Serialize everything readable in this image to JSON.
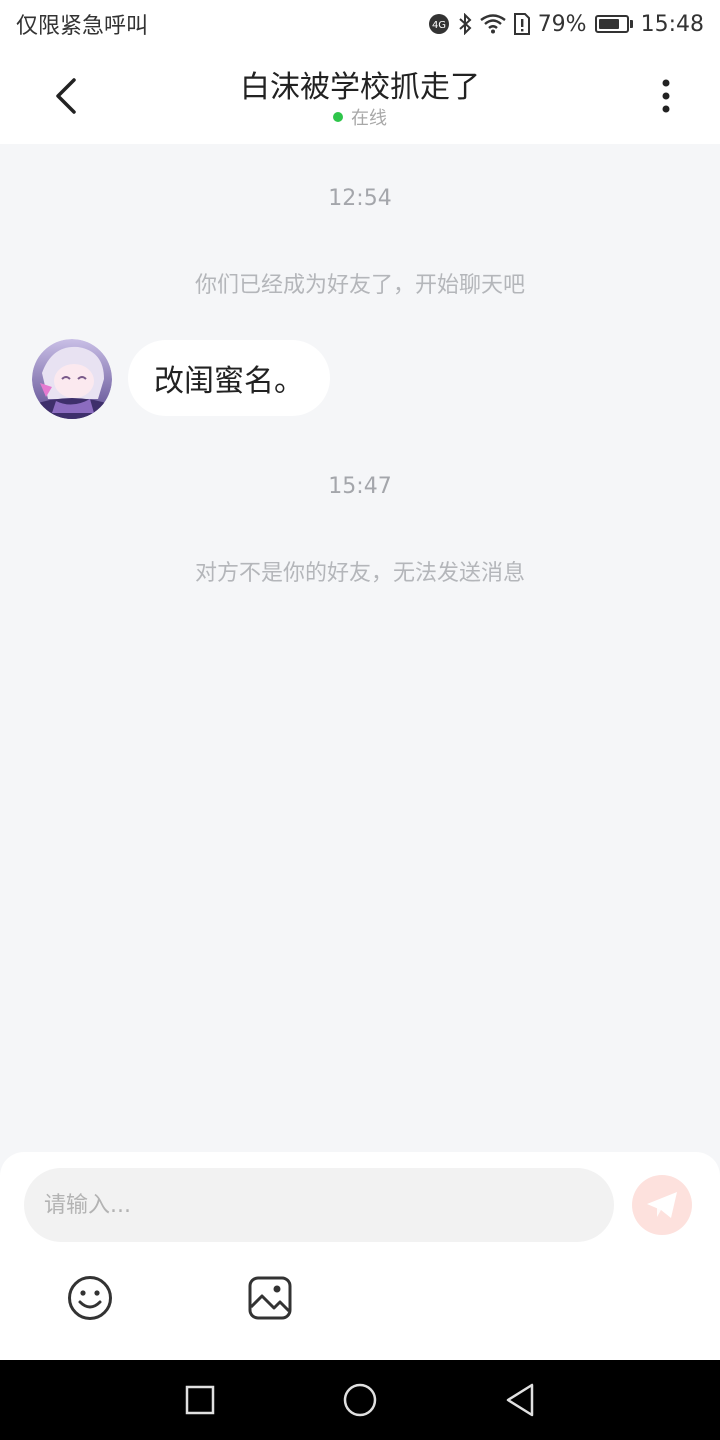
{
  "status_bar": {
    "carrier_text": "仅限紧急呼叫",
    "battery_percent": "79%",
    "battery_level": 0.79,
    "time": "15:48",
    "icons": [
      "hd-call-icon",
      "bluetooth-icon",
      "wifi-icon",
      "sim-alert-icon",
      "battery-icon"
    ]
  },
  "header": {
    "title": "白沫被学校抓走了",
    "status_text": "在线",
    "status_color": "#2ec54a",
    "back_icon": "chevron-left-icon",
    "more_icon": "more-vertical-icon"
  },
  "chat": {
    "items": [
      {
        "type": "timestamp",
        "text": "12:54"
      },
      {
        "type": "system",
        "text": "你们已经成为好友了，开始聊天吧"
      },
      {
        "type": "message",
        "from": "contact",
        "text": "改闺蜜名。"
      },
      {
        "type": "timestamp",
        "text": "15:47"
      },
      {
        "type": "system",
        "text": "对方不是你的好友，无法发送消息"
      }
    ]
  },
  "composer": {
    "placeholder": "请输入...",
    "send_icon": "paper-plane-icon",
    "send_color": "#fde1dd",
    "tools": [
      "emoji-icon",
      "image-icon"
    ]
  },
  "nav_bar": {
    "icons": [
      "recents-square-icon",
      "home-circle-icon",
      "back-triangle-icon"
    ]
  }
}
